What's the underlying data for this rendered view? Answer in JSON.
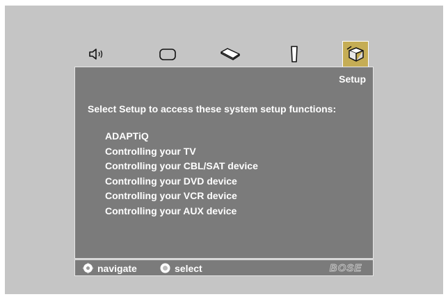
{
  "tabs": [
    {
      "name": "audio",
      "icon": "speaker-icon",
      "active": false
    },
    {
      "name": "video",
      "icon": "tv-screen-icon",
      "active": false
    },
    {
      "name": "source",
      "icon": "disc-tray-icon",
      "active": false
    },
    {
      "name": "remote",
      "icon": "remote-icon",
      "active": false
    },
    {
      "name": "setup",
      "icon": "setup-box-icon",
      "active": true
    }
  ],
  "panel": {
    "title": "Setup",
    "prompt": "Select Setup to access these system setup functions:",
    "items": [
      {
        "label": "ADAPTiQ"
      },
      {
        "label": "Controlling your TV"
      },
      {
        "label": "Controlling your CBL/SAT device"
      },
      {
        "label": "Controlling your DVD device"
      },
      {
        "label": "Controlling your VCR device"
      },
      {
        "label": "Controlling your AUX device"
      }
    ]
  },
  "footer": {
    "navigate_label": "navigate",
    "select_label": "select",
    "brand": "BOSE"
  },
  "colors": {
    "background": "#c5c5c5",
    "panel": "#7b7b7b",
    "accent": "#c5ad55",
    "text": "#ffffff"
  }
}
